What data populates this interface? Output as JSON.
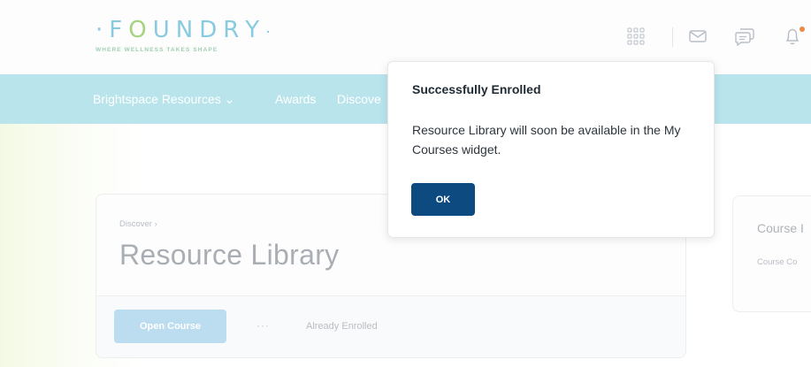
{
  "header": {
    "logo_letters": [
      "F",
      "O",
      "U",
      "N",
      "D",
      "R",
      "Y"
    ],
    "logo_prefix": "·",
    "logo_suffix": "·",
    "tagline": "WHERE WELLNESS TAKES SHAPE",
    "icons": [
      "grid-icon",
      "mail-icon",
      "chat-icon",
      "bell-icon"
    ]
  },
  "nav": {
    "items": [
      {
        "label": "Brightspace Resources ⌄"
      },
      {
        "label": "Awards"
      },
      {
        "label": "Discove"
      }
    ]
  },
  "course": {
    "breadcrumb": "Discover ›",
    "title": "Resource Library",
    "open_button": "Open Course",
    "more": "···",
    "status": "Already Enrolled"
  },
  "side_card": {
    "title": "Course I",
    "subtitle": "Course Co"
  },
  "dialog": {
    "title": "Successfully Enrolled",
    "body": "Resource Library will soon be available in the My Courses widget.",
    "ok_label": "OK"
  },
  "colors": {
    "logo_letters": [
      "#88cbe0",
      "#a5d47e",
      "#88cbe0",
      "#88cbe0",
      "#88cbe0",
      "#88cbe0",
      "#88cbe0"
    ],
    "nav_bar": "#b9e4ec",
    "ok_button": "#0d4a80",
    "open_button": "#bcdcef",
    "notification_dot": "#e98a46"
  }
}
